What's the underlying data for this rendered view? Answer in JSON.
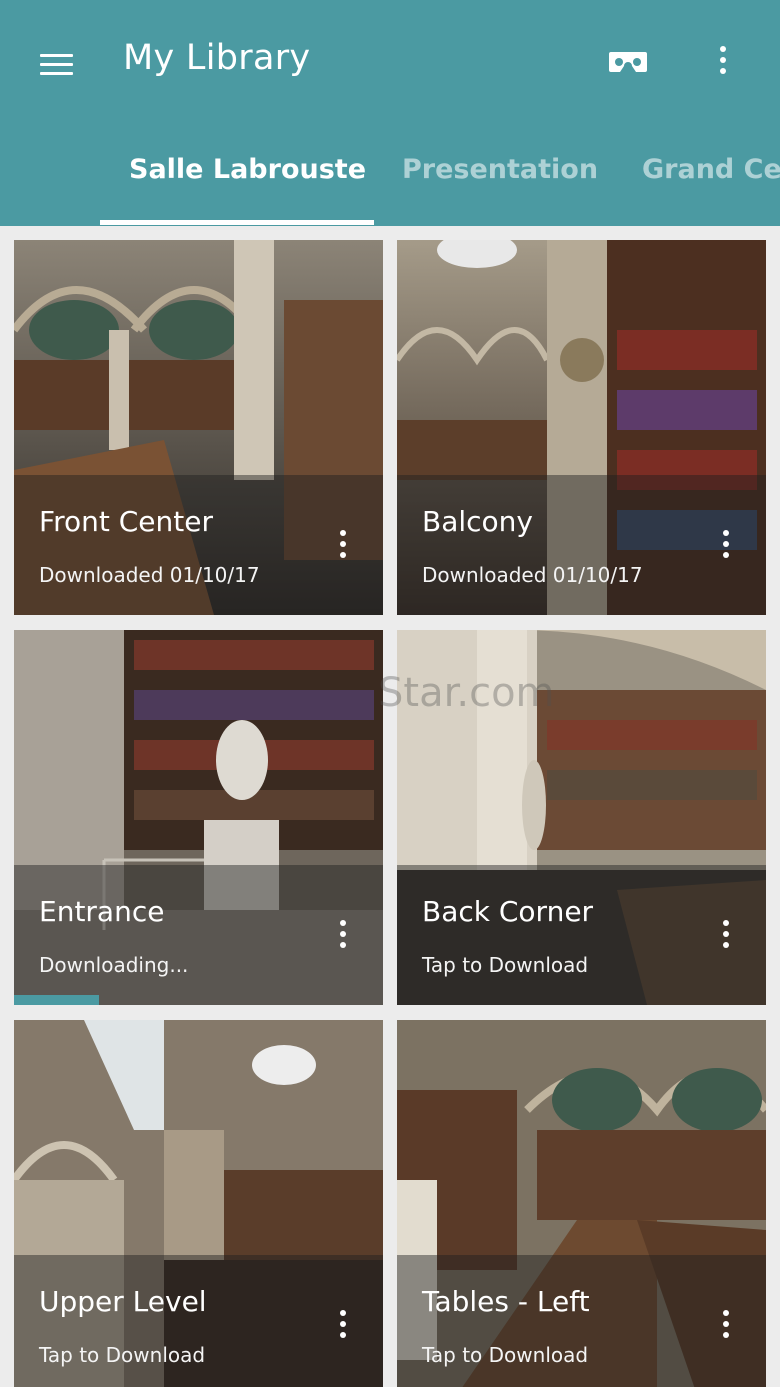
{
  "app": {
    "title": "My Library",
    "accent": "#4b9aa2"
  },
  "toolbar": {
    "menu_icon": "hamburger-menu-icon",
    "vr_icon": "vr-headset-icon",
    "overflow_icon": "more-vert-icon"
  },
  "tabs": [
    {
      "label": "Salle Labrouste",
      "active": true
    },
    {
      "label": "Presentation",
      "active": false
    },
    {
      "label": "Grand Center",
      "active": false
    }
  ],
  "watermark": "Star.com",
  "cards": [
    {
      "title": "Front Center",
      "status": "Downloaded 01/10/17"
    },
    {
      "title": "Balcony",
      "status": "Downloaded 01/10/17"
    },
    {
      "title": "Entrance",
      "status": "Downloading...",
      "progress": 0.23
    },
    {
      "title": "Back Corner",
      "status": "Tap to Download"
    },
    {
      "title": "Upper Level",
      "status": "Tap to Download"
    },
    {
      "title": "Tables - Left",
      "status": "Tap to Download"
    }
  ]
}
